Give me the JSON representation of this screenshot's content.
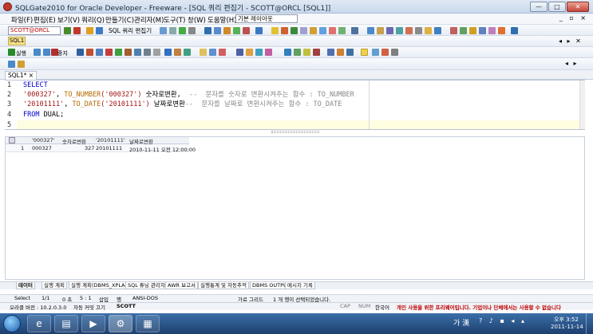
{
  "window": {
    "title": "SQLGate2010 for Oracle Developer - Freeware - [SQL 쿼리 편집기 - SCOTT@ORCL [SQL1]]",
    "min": "—",
    "max": "□",
    "close": "✕"
  },
  "menu": {
    "items": [
      "파일(F)",
      "편집(E)",
      "보기(V)",
      "쿼리(Q)",
      "만들기(C)",
      "관리자(M)",
      "도구(T)",
      "창(W)",
      "도움말(H)"
    ],
    "layout": "기본 레이아웃"
  },
  "toolbar": {
    "connection": "SCOTT@ORCL",
    "sql_editor": "SQL 쿼리 편집기",
    "active_tab": "SQL1",
    "execute": "실행",
    "stop": "중지"
  },
  "editor": {
    "tab": "SQL1*",
    "line_numbers": [
      "1",
      "2",
      "3",
      "4",
      "5"
    ],
    "line1": {
      "kw": "SELECT"
    },
    "line2": {
      "str": "'000327'",
      "sep": ", ",
      "fn": "TO_NUMBER",
      "arg": "('000327')",
      "alias": " 숫자로변환",
      "comma": ",",
      "comment": "  --  문자를 숫자로 변환시켜주는 함수 : TO_NUMBER"
    },
    "line3": {
      "str": "'20101111'",
      "sep": ", ",
      "fn": "TO_DATE",
      "arg": "('20101111')",
      "alias": " 날짜로변환",
      "comment": "--  문자를 날짜로 변환시켜주는 함수 : TO_DATE"
    },
    "line4": {
      "kw": "FROM",
      "rest": " DUAL;"
    }
  },
  "grid": {
    "headers": [
      "'000327'",
      "숫자로변환",
      "'20101111'",
      "날짜로변환"
    ],
    "row": {
      "num": "1",
      "c1": "000327",
      "c2": "327",
      "c3": "20101111",
      "c4": "2010-11-11 오전 12:00:00"
    }
  },
  "result_tabs": [
    "데이터",
    "실행 계획",
    "실행 계획(DBMS_XPLAN)",
    "SQL 튜닝 관리자",
    "AWR 보고서",
    "실행통계 및 자동추적",
    "DBMS OUTPUT",
    "메시지 기록"
  ],
  "status": {
    "mode": "Select",
    "rows": "1/1",
    "rows_label": "0 초",
    "cursor": "5 : 1",
    "insert": "삽입",
    "row_label": "행",
    "encoding": "ANSI-DOS",
    "grid": "가로 그리드",
    "selected": "1 개 행이 선택되었습니다.",
    "oracle_version": "오라클 버전 : 10.2.0.3.0",
    "autocommit": "자동 커밋 끄기",
    "user": "SCOTT",
    "cap": "CAP",
    "num": "NUM",
    "lang": "한국어",
    "notice": "개인 사용을 위한 프리웨어입니다. 기업이나 단체에서는 사용할 수 없습니다"
  },
  "taskbar": {
    "lang": "가 漢",
    "time": "오후 3:52",
    "date": "2011-11-14"
  }
}
